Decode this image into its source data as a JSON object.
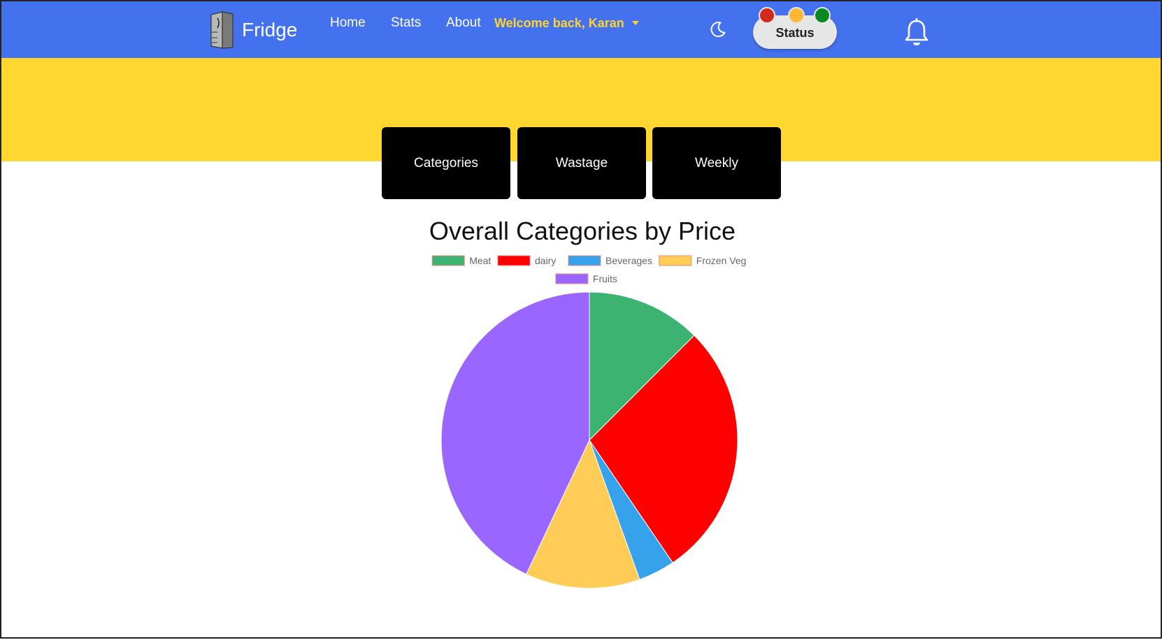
{
  "nav": {
    "brand": "Fridge",
    "links": [
      "Home",
      "Stats",
      "About"
    ],
    "welcome": "Welcome back, Karan",
    "status_label": "Status",
    "status_lights": [
      "#d22a1a",
      "#ffb834",
      "#0a8a1e"
    ]
  },
  "tabs": [
    "Categories",
    "Wastage",
    "Weekly"
  ],
  "colors": {
    "navbar": "#4472ef",
    "hero": "#ffd730",
    "tab_bg": "#000000"
  },
  "icons": {
    "brand": "fridge-icon",
    "theme": "moon-icon",
    "notifications": "bell-icon"
  },
  "chart_data": {
    "type": "pie",
    "title": "Overall Categories by Price",
    "legend_position": "top",
    "labels": [
      "Meat",
      "dairy",
      "Beverages",
      "Frozen Veg",
      "Fruits"
    ],
    "values": [
      12.5,
      28.0,
      4.0,
      12.5,
      43.0
    ],
    "colors": [
      "#3cb371",
      "#ff0000",
      "#36a2eb",
      "#ffcd56",
      "#9966ff"
    ]
  }
}
